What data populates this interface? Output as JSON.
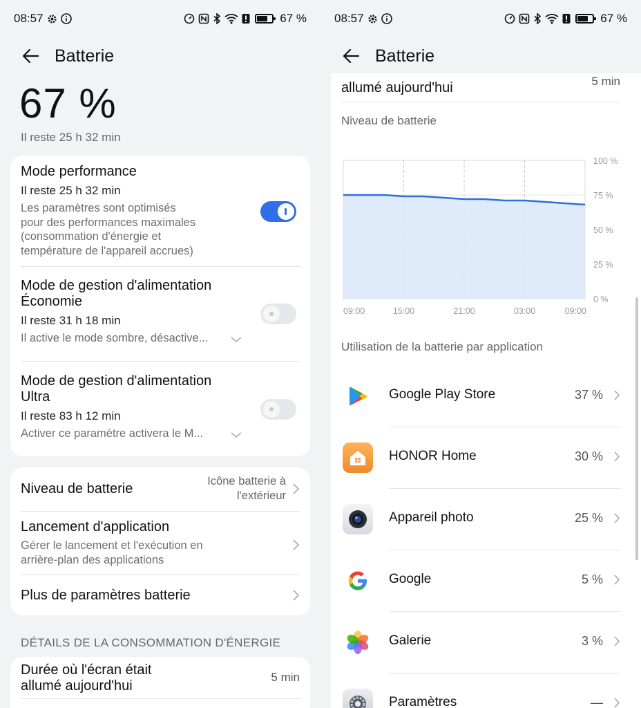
{
  "status": {
    "time": "08:57",
    "battery_pct": "67 %"
  },
  "header": {
    "title": "Batterie"
  },
  "summary": {
    "percent": "67 %",
    "remaining": "Il reste 25 h 32 min"
  },
  "modes": [
    {
      "title": "Mode performance",
      "remaining": "Il reste 25 h 32 min",
      "desc": [
        "Les paramètres sont optimisés",
        "pour des performances maximales",
        "(consommation d'énergie et",
        "température de l'appareil accrues)"
      ],
      "enabled": true
    },
    {
      "title": [
        "Mode de gestion d'alimentation",
        "Économie"
      ],
      "remaining": "Il reste 31 h 18 min",
      "desc": "Il active le mode sombre, désactive...",
      "enabled": false
    },
    {
      "title": [
        "Mode de gestion d'alimentation",
        "Ultra"
      ],
      "remaining": "Il reste 83 h 12 min",
      "desc": "Activer ce paramètre activera le M...",
      "enabled": false
    }
  ],
  "settings": {
    "battery_level": {
      "label": "Niveau de batterie",
      "value": [
        "Icône batterie à",
        "l'extérieur"
      ]
    },
    "app_launch": {
      "label": "Lancement d'application",
      "desc": [
        "Gérer le lancement et l'exécution en",
        "arrière-plan des applications"
      ]
    },
    "more": {
      "label": "Plus de paramètres batterie"
    }
  },
  "details": {
    "section": "DÉTAILS DE LA CONSOMMATION D'ÉNERGIE",
    "screen_on": {
      "label": [
        "Durée où l'écran était",
        "allumé aujourd'hui"
      ],
      "value": "5 min"
    }
  },
  "right": {
    "top_partial": {
      "label": "allumé aujourd'hui",
      "value": "5 min"
    },
    "chart_section": "Niveau de batterie",
    "usage_section": "Utilisation de la batterie par application",
    "apps": [
      {
        "name": "Google Play Store",
        "pct": "37 %",
        "icon": "google-play-icon"
      },
      {
        "name": "HONOR Home",
        "pct": "30 %",
        "icon": "honor-home-icon"
      },
      {
        "name": "Appareil photo",
        "pct": "25 %",
        "icon": "camera-icon"
      },
      {
        "name": "Google",
        "pct": "5 %",
        "icon": "google-icon"
      },
      {
        "name": "Galerie",
        "pct": "3 %",
        "icon": "gallery-icon"
      },
      {
        "name": "Paramètres",
        "pct": "—",
        "icon": "settings-icon"
      }
    ]
  },
  "chart_data": {
    "type": "area",
    "x_ticks": [
      "09:00",
      "15:00",
      "21:00",
      "03:00",
      "09:00"
    ],
    "y_ticks": [
      "100 %",
      "75 %",
      "50 %",
      "25 %",
      "0 %"
    ],
    "ylim": [
      0,
      100
    ],
    "x_hours": [
      0,
      4,
      6,
      8,
      10,
      12,
      14,
      16,
      18,
      20,
      22,
      24
    ],
    "y": [
      75,
      75,
      74,
      74,
      73,
      72,
      72,
      71,
      71,
      70,
      69,
      68
    ],
    "line_color": "#2f6fd6",
    "fill_color": "#dce8fb"
  },
  "colors": {
    "accent": "#2f6fe8"
  }
}
